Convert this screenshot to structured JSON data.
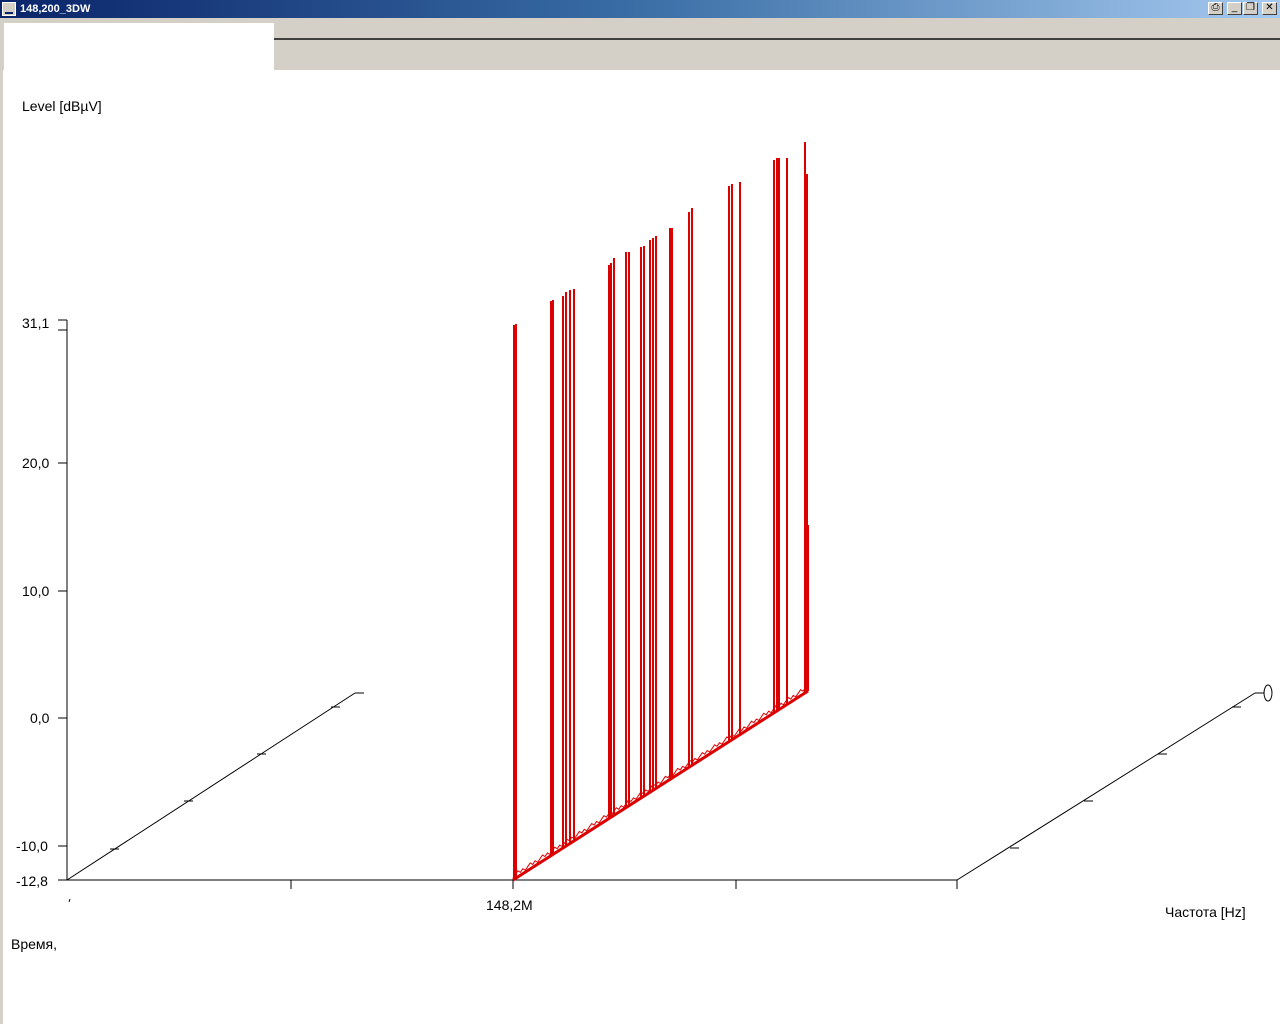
{
  "window": {
    "title": "148,200_3DW",
    "buttons": {
      "print": "⎙",
      "minimize": "_",
      "restore": "❐",
      "close": "✕"
    }
  },
  "plot": {
    "z_label": "Level [dBµV]",
    "x_label": "Частота [Hz]",
    "y_label": "Время,",
    "z_ticks": [
      "31,1",
      "20,0",
      "10,0",
      "0,0",
      "-10,0",
      "-12,8"
    ],
    "freq_tick": "148,2M",
    "series_color": "#dd0000"
  }
}
